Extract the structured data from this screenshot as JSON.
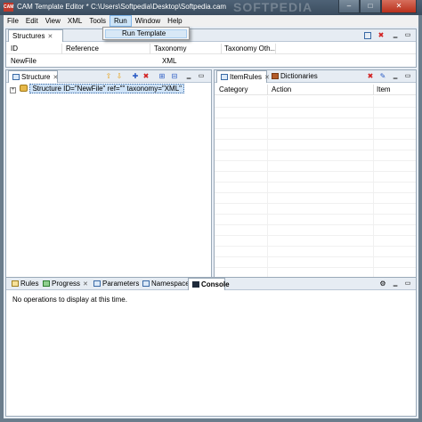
{
  "window": {
    "title": "CAM Template Editor * C:\\Users\\Softpedia\\Desktop\\Softpedia.cam",
    "app_icon_text": "CAM",
    "brand": "SOFTPEDIA",
    "minimize": "–",
    "maximize": "□",
    "close": "✕"
  },
  "menubar": [
    "File",
    "Edit",
    "View",
    "XML",
    "Tools",
    "Run",
    "Window",
    "Help"
  ],
  "run_menu": {
    "item": "Run Template"
  },
  "structures": {
    "tab": "Structures",
    "columns": [
      "ID",
      "Reference",
      "Taxonomy",
      "Taxonomy Oth..."
    ],
    "rows": [
      {
        "id": "NewFile",
        "reference": "",
        "taxonomy": "XML",
        "taxonomy_other": ""
      }
    ]
  },
  "structure": {
    "tab": "Structure",
    "node": "Structure ID=\"NewFile\" ref=\"\" taxonomy=\"XML\""
  },
  "right_panel": {
    "tabs": [
      "ItemRules",
      "Dictionaries"
    ],
    "columns": [
      "Category",
      "Action",
      "Item"
    ]
  },
  "bottom_panel": {
    "tabs": [
      "Rules",
      "Progress",
      "Parameters",
      "Namespaces",
      "Console"
    ],
    "message": "No operations to display at this time."
  },
  "icons": {
    "tab_close": "✕",
    "up": "⇧",
    "down": "⇩",
    "add": "✚",
    "delete": "✖",
    "expand": "+",
    "scroll_left": "◀",
    "scroll_right": "▶"
  },
  "colors": {
    "accent": "#3a6aa6",
    "delete": "#d22020",
    "arrow": "#e6a21a"
  }
}
